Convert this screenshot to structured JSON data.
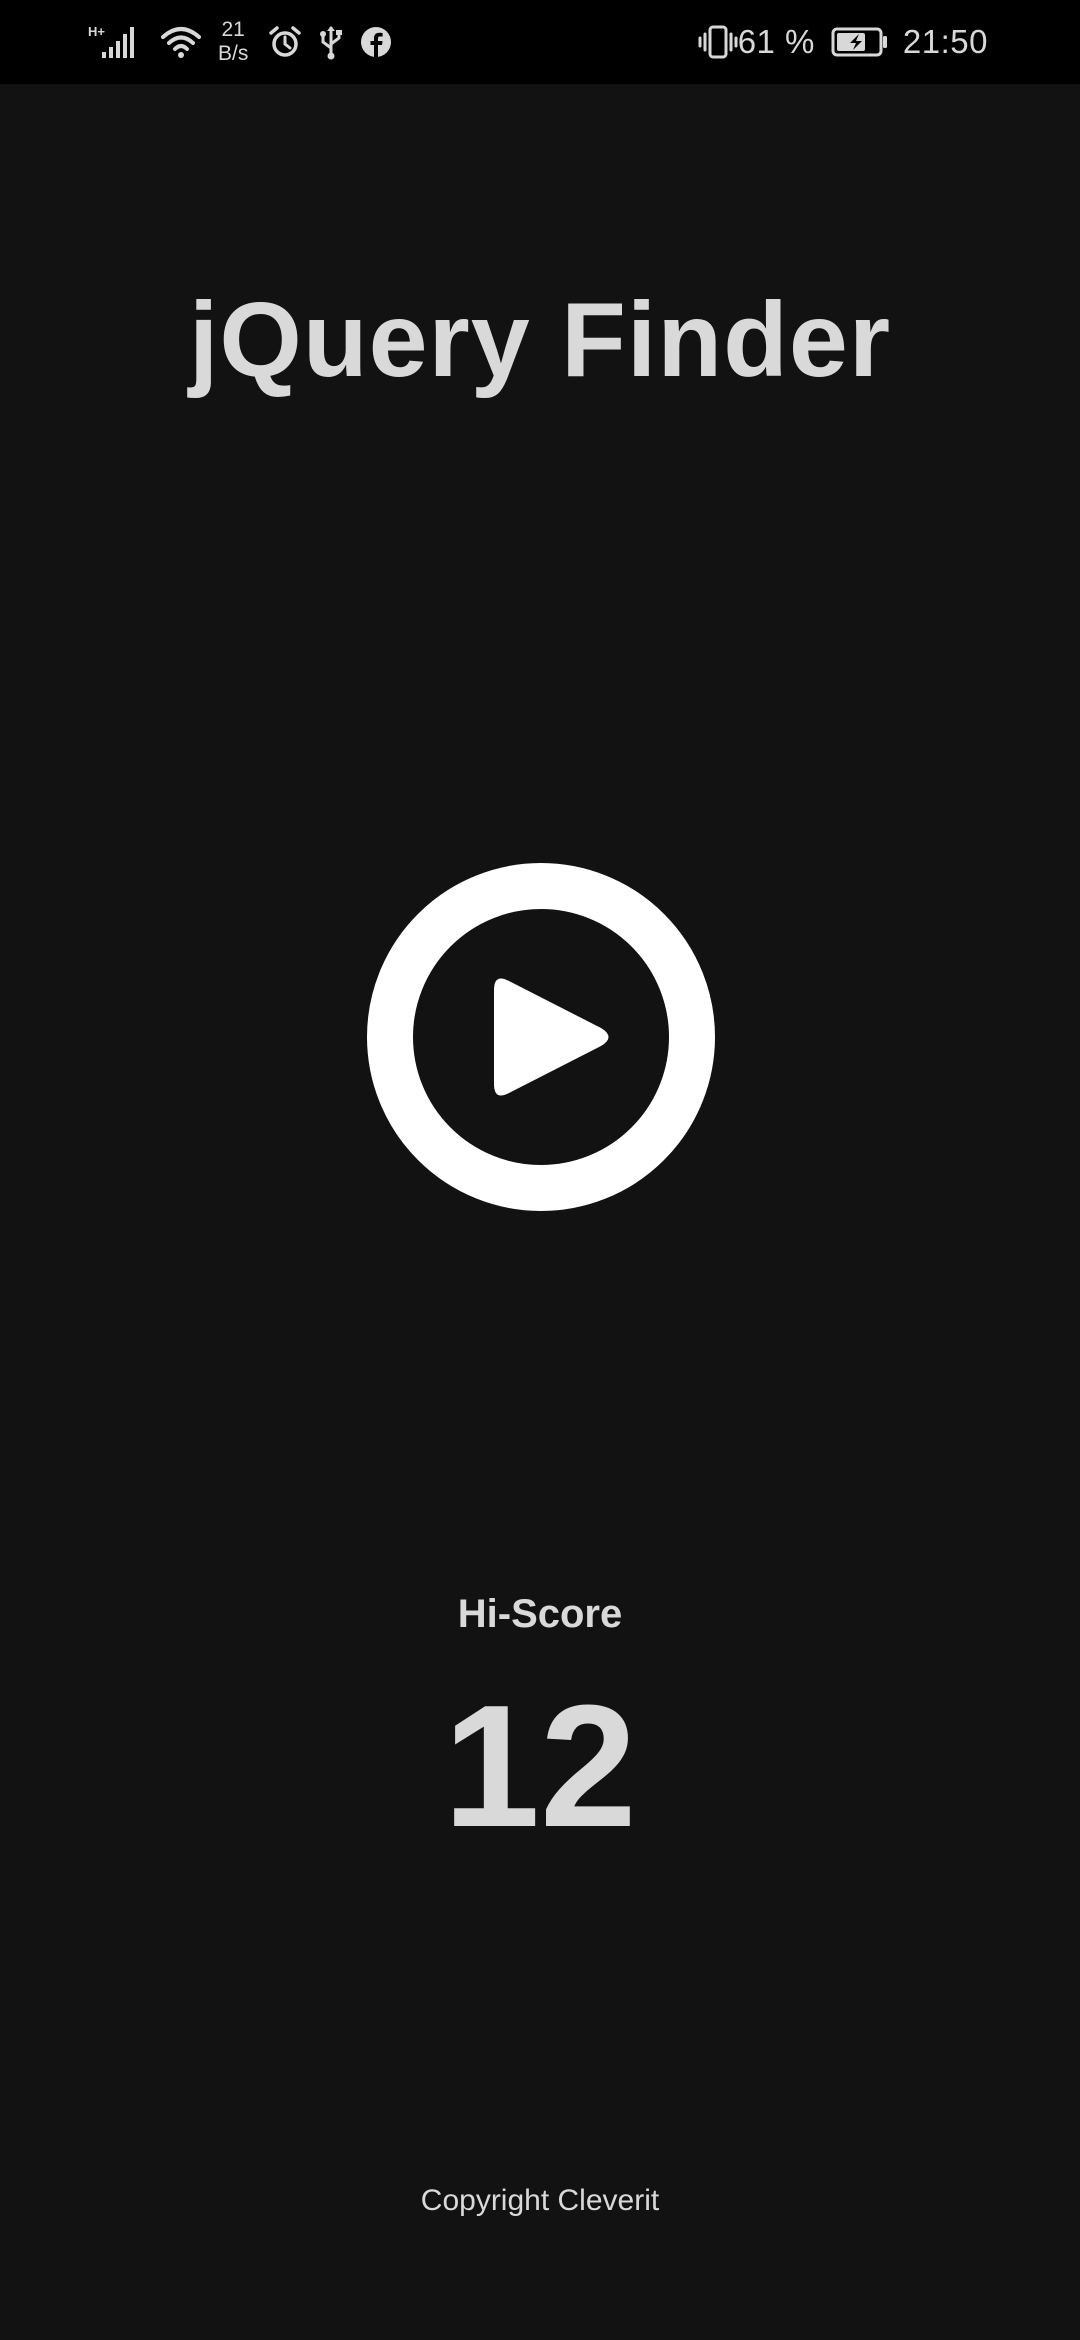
{
  "status_bar": {
    "signal_type": "H+",
    "net_rate_value": "21",
    "net_rate_unit": "B/s",
    "battery_percent": "61 %",
    "time": "21:50",
    "icons": [
      "signal-icon",
      "wifi-icon",
      "alarm-icon",
      "usb-icon",
      "facebook-icon",
      "vibrate-icon",
      "battery-charging-icon"
    ]
  },
  "app": {
    "title": "jQuery Finder",
    "play_icon": "play-circle-icon"
  },
  "hiscore": {
    "label": "Hi-Score",
    "value": "12"
  },
  "footer": {
    "copyright": "Copyright Cleverit"
  },
  "colors": {
    "background": "#121212",
    "status_bar": "#000000",
    "text": "#d9d9d9",
    "play_button": "#ffffff"
  }
}
